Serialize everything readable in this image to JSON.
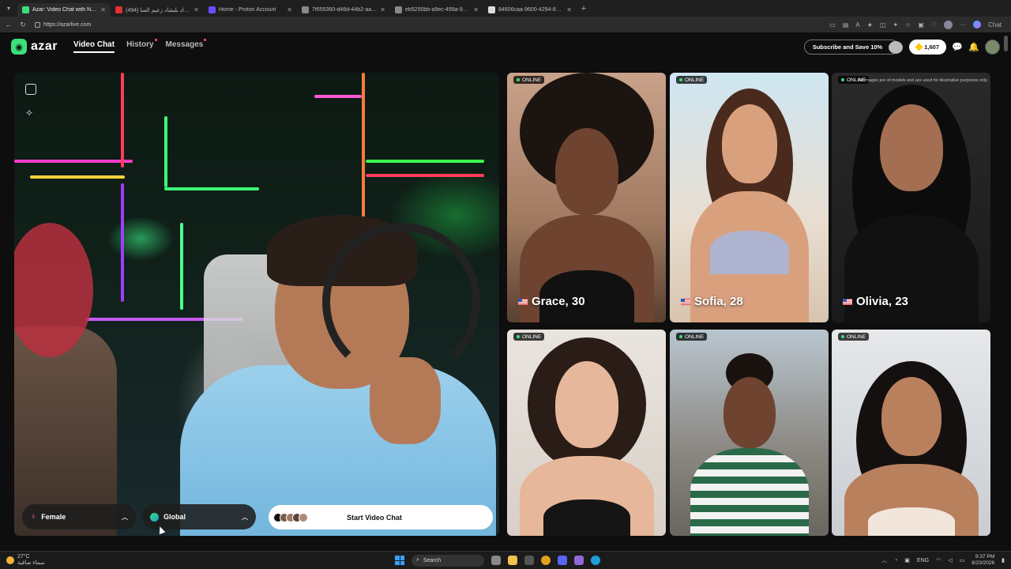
{
  "browser": {
    "tabs": [
      {
        "title": "Azar: Video Chat with New Fr",
        "active": true,
        "color": "#3ce07a"
      },
      {
        "title": "(494) موسيقى مراد بلبشاد زعيم السا",
        "active": false,
        "color": "#e03030"
      },
      {
        "title": "Home - Proton Account",
        "active": false,
        "color": "#6d4aff"
      },
      {
        "title": "7f655360-d46d-44b2-aa5b-11ba",
        "active": false,
        "color": "#888888"
      },
      {
        "title": "eb5250bb-a9ec-499a-96f-6980c",
        "active": false,
        "color": "#888888"
      },
      {
        "title": "84606caa-9600-4294-8b29-4ed3f",
        "active": false,
        "color": "#dddddd"
      }
    ],
    "url": "https://azarlive.com",
    "chat_label": "Chat"
  },
  "header": {
    "logo": "azar",
    "nav": [
      {
        "label": "Video Chat",
        "active": true,
        "dot": false
      },
      {
        "label": "History",
        "active": false,
        "dot": true
      },
      {
        "label": "Messages",
        "active": false,
        "dot": true
      }
    ],
    "subscribe_label": "Subscribe and Save 10%",
    "gems": "1,607"
  },
  "controls": {
    "gender": "Female",
    "region": "Global",
    "start_label": "Start Video Chat"
  },
  "disclaimer": "All images are of models and are used for illustrative purposes only",
  "profiles": [
    {
      "name": "Grace, 30",
      "status": "ONLINE"
    },
    {
      "name": "Sofia, 28",
      "status": "ONLINE"
    },
    {
      "name": "Olivia, 23",
      "status": "ONLINE"
    },
    {
      "name": "",
      "status": "ONLINE"
    },
    {
      "name": "",
      "status": "ONLINE"
    },
    {
      "name": "",
      "status": "ONLINE"
    }
  ],
  "taskbar": {
    "temperature": "27°C",
    "weather": "سماء صافية",
    "search": "Search",
    "lang": "ENG",
    "time": "9:37 PM",
    "date": "8/23/2026"
  }
}
